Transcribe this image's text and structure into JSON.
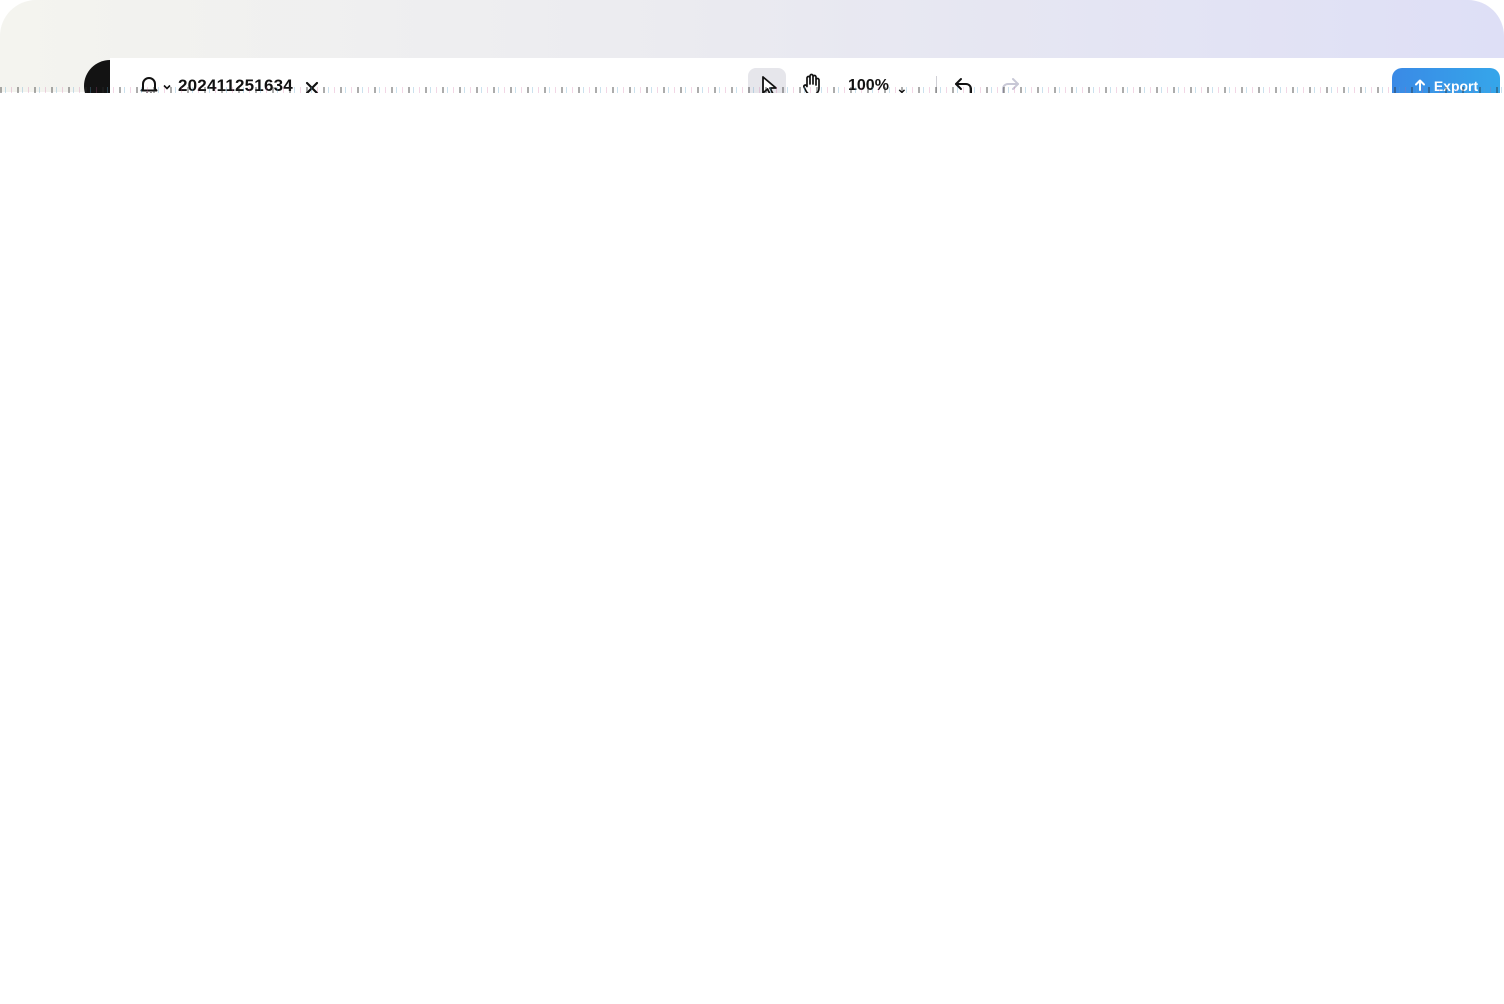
{
  "document": {
    "title": "202411251634"
  },
  "toolbar": {
    "zoom_label": "100%",
    "zoom_caret": "⌄",
    "export_label": "Export"
  },
  "icons": {
    "bell": "bell-icon",
    "close": "close-icon",
    "select": "cursor-arrow-icon",
    "hand": "hand-pan-icon",
    "undo": "undo-icon",
    "redo": "redo-icon",
    "export": "upload-arrow-icon"
  },
  "colors": {
    "accent": "#3a8ae6",
    "header_gradient_start": "#f4f4ef",
    "header_gradient_end": "#dedff6",
    "text": "#111111",
    "disabled": "#c8c8d6"
  }
}
